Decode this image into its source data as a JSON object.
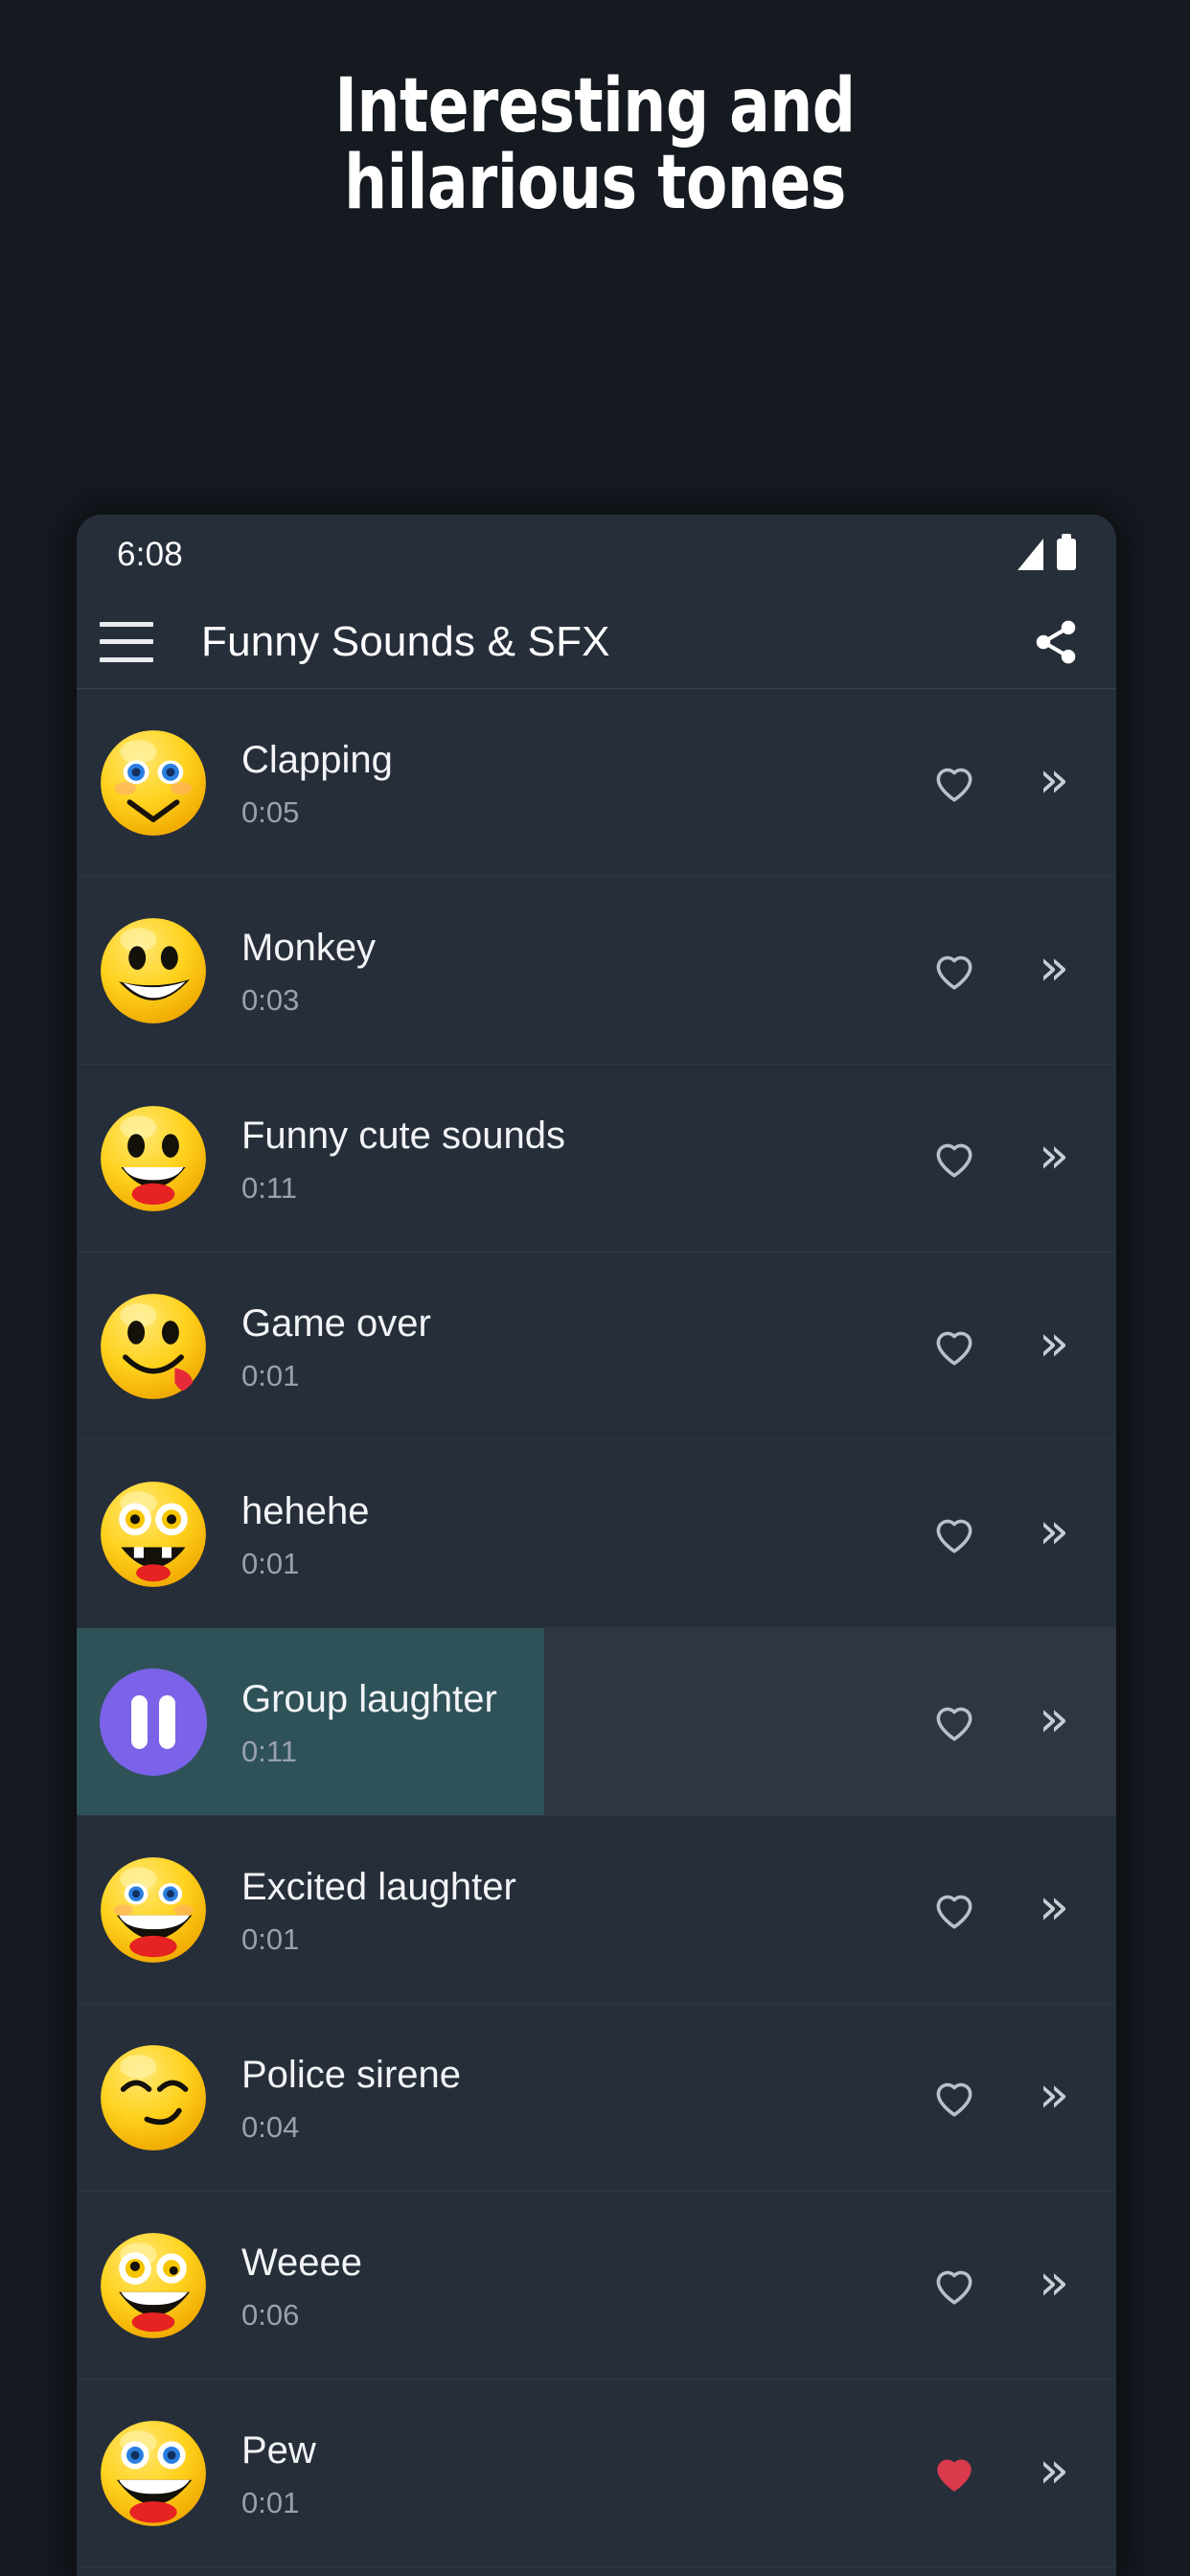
{
  "promo": {
    "headline": "Interesting and\nhilarious tones"
  },
  "phone": {
    "status_bar": {
      "time": "6:08",
      "signal_icon": "signal-bars-icon",
      "battery_icon": "battery-full-icon"
    },
    "app_bar": {
      "menu_icon": "hamburger-menu-icon",
      "title": "Funny Sounds & SFX",
      "share_icon": "share-icon"
    },
    "list": {
      "heart_outline_icon": "heart-outline-icon",
      "heart_filled_icon": "heart-filled-icon",
      "next_icon": "double-chevron-right-icon",
      "next_glyph": "»",
      "pause_icon": "pause-icon",
      "rows": [
        {
          "title": "Clapping",
          "duration": "0:05",
          "emoji": "smiley-blue-eyes-v-smile",
          "favorite": false,
          "playing": false,
          "progress": 0
        },
        {
          "title": "Monkey",
          "duration": "0:03",
          "emoji": "smiley-grin-teeth",
          "favorite": false,
          "playing": false,
          "progress": 0
        },
        {
          "title": "Funny cute sounds",
          "duration": "0:11",
          "emoji": "smiley-open-mouth-laugh",
          "favorite": false,
          "playing": false,
          "progress": 0
        },
        {
          "title": "Game over",
          "duration": "0:01",
          "emoji": "smiley-tongue-out",
          "favorite": false,
          "playing": false,
          "progress": 0
        },
        {
          "title": "hehehe",
          "duration": "0:01",
          "emoji": "smiley-wide-eyes-teeth",
          "favorite": false,
          "playing": false,
          "progress": 0
        },
        {
          "title": "Group laughter",
          "duration": "0:11",
          "emoji": "pause-button",
          "favorite": false,
          "playing": true,
          "progress": 45
        },
        {
          "title": "Excited laughter",
          "duration": "0:01",
          "emoji": "smiley-big-grin-blue-eyes",
          "favorite": false,
          "playing": false,
          "progress": 0
        },
        {
          "title": "Police sirene",
          "duration": "0:04",
          "emoji": "smiley-smirk-closed-eyes",
          "favorite": false,
          "playing": false,
          "progress": 0
        },
        {
          "title": "Weeee",
          "duration": "0:06",
          "emoji": "smiley-crazy-eyes-laugh",
          "favorite": false,
          "playing": false,
          "progress": 0
        },
        {
          "title": "Pew",
          "duration": "0:01",
          "emoji": "smiley-blue-eyes-laugh",
          "favorite": true,
          "playing": false,
          "progress": 0
        }
      ]
    }
  },
  "colors": {
    "page_background": "#151a21",
    "app_background": "#262e3a",
    "row_playing_background": "#2e3642",
    "progress_teal": "#2f5259",
    "pause_purple": "#7b62e8",
    "heart_red": "#d93a4c",
    "title_text": "#f2f4f7",
    "duration_text": "#99a1ac",
    "emoji_yellow": "#ffd21e"
  }
}
